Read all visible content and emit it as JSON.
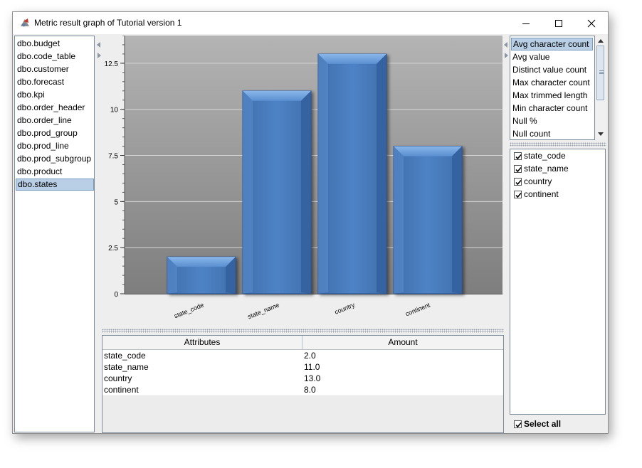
{
  "window": {
    "title": "Metric result graph of Tutorial version 1"
  },
  "tables": {
    "items": [
      "dbo.budget",
      "dbo.code_table",
      "dbo.customer",
      "dbo.forecast",
      "dbo.kpi",
      "dbo.order_header",
      "dbo.order_line",
      "dbo.prod_group",
      "dbo.prod_line",
      "dbo.prod_subgroup",
      "dbo.product",
      "dbo.states"
    ],
    "selected_index": 11
  },
  "metrics": {
    "items": [
      "Avg character count",
      "Avg value",
      "Distinct value count",
      "Max character count",
      "Max trimmed length",
      "Min character count",
      "Null %",
      "Null count"
    ],
    "selected_index": 0
  },
  "attributes": {
    "items": [
      {
        "label": "state_code",
        "checked": true
      },
      {
        "label": "state_name",
        "checked": true
      },
      {
        "label": "country",
        "checked": true
      },
      {
        "label": "continent",
        "checked": true
      }
    ],
    "select_all_label": "Select all",
    "select_all_checked": true
  },
  "result_table": {
    "columns": [
      "Attributes",
      "Amount"
    ],
    "rows": [
      {
        "attribute": "state_code",
        "amount": "2.0"
      },
      {
        "attribute": "state_name",
        "amount": "11.0"
      },
      {
        "attribute": "country",
        "amount": "13.0"
      },
      {
        "attribute": "continent",
        "amount": "8.0"
      }
    ]
  },
  "chart_data": {
    "type": "bar",
    "categories": [
      "state_code",
      "state_name",
      "country",
      "continent"
    ],
    "values": [
      2,
      11,
      13,
      8
    ],
    "ylim": [
      0,
      14
    ],
    "yticks": [
      0,
      2.5,
      5,
      7.5,
      10,
      12.5
    ],
    "ytick_labels": [
      "0",
      "2.5",
      "5",
      "7.5",
      "10",
      "12.5"
    ],
    "grid": true,
    "colors": {
      "bar": "#4a7ec0",
      "bar_top": "#7aaae2",
      "plot_top": "#b4b4b4",
      "plot_bottom": "#7e7e7e"
    }
  }
}
